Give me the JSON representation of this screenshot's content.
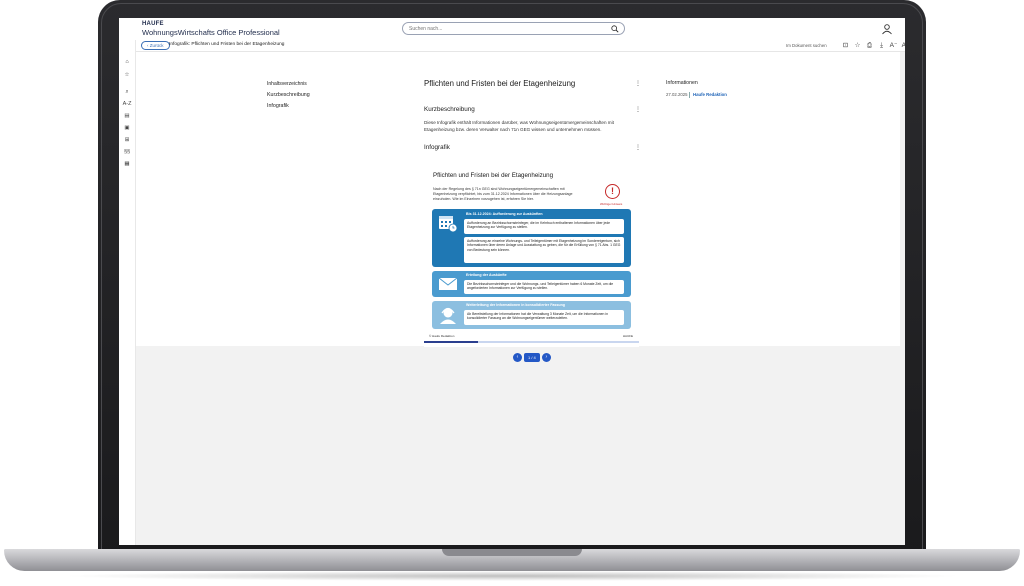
{
  "header": {
    "logo": "HAUFE",
    "app_title": "WohnungsWirtschafts Office Professional",
    "search_placeholder": "Suchen nach..."
  },
  "toolbar": {
    "back_label": "‹ Zurück",
    "breadcrumb": "Infografik: Pflichten und Fristen bei der Etagenheizung",
    "in_doc_search": "Im Dokument suchen"
  },
  "rail": {
    "items": [
      "home-icon",
      "star-icon",
      "search-icon",
      "A-Z",
      "book-icon",
      "news-icon",
      "tools-icon",
      "§§",
      "calculator-icon"
    ],
    "az_label": "A-Z",
    "paragraph_label": "§§"
  },
  "toc": {
    "title": "Inhaltsverzeichnis",
    "items": [
      "Kurzbeschreibung",
      "Infografik"
    ]
  },
  "document": {
    "title": "Pflichten und Fristen bei der Etagenheizung",
    "section1_title": "Kurzbeschreibung",
    "section1_text": "Diese Infografik enthält Informationen darüber, was Wohnungseigentümergemeinschaften mit Etagenheizung bzw. deren Verwalter nach 71n GEG wissen und unternehmen müssen.",
    "section2_title": "Infografik"
  },
  "info_panel": {
    "title": "Informationen",
    "date": "27.02.2025",
    "author": "Haufe Redaktion"
  },
  "infographic": {
    "title": "Pflichten und Fristen bei der Etagenheizung",
    "intro": "Nach der Regelung des § 71n GEG sind Wohnungseigentümergemeinschaften mit Etagenheizung verpflichtet, bis zum 31.12.2024 Informationen über die Heizungsanlage einzuholen. Wie im Einzelnen vorzugehen ist, erfahren Sie hier.",
    "warn_label": "Wichtiger Hinweis",
    "block1_head": "Bis 31.12.2024: Aufforderung zur Auskünften",
    "block1_item1": "Aufforderung an Bezirksschornsteinfeger, die im Kehrbuch enthaltenen Informationen über jede Etagenheizung zur Verfügung zu stellen.",
    "block1_item2": "Aufforderung an einzelne Wohnungs- und Teileigentümer mit Etagenheizung im Sondereigentum, sich Informationen über deren Anlage und Ausstattung zu geben, die für die Erfüllung von § 71 Abs. 1 GEG von Bedeutung sein können.",
    "block2_head": "Erteilung der Auskünfte",
    "block2_text": "Die Bezirksschornsteinfeger und die Wohnungs- und Teileigentümer haben 6 Monate Zeit, um die angeforderten Informationen zur Verfügung zu stellen.",
    "block3_head": "Weiterleitung der Informationen in konsolidierter Fassung",
    "block3_text": "Ab Bereitstellung der Informationen hat die Verwaltung 3 Monate Zeit, um die Informationen in konsolidierter Fassung an die Wohnungseigentümer weiterzuleiten.",
    "footer_left": "© Haufe Redaktion",
    "footer_right": "HAUFE",
    "progress": 0.25,
    "pager": "1 / 4"
  }
}
